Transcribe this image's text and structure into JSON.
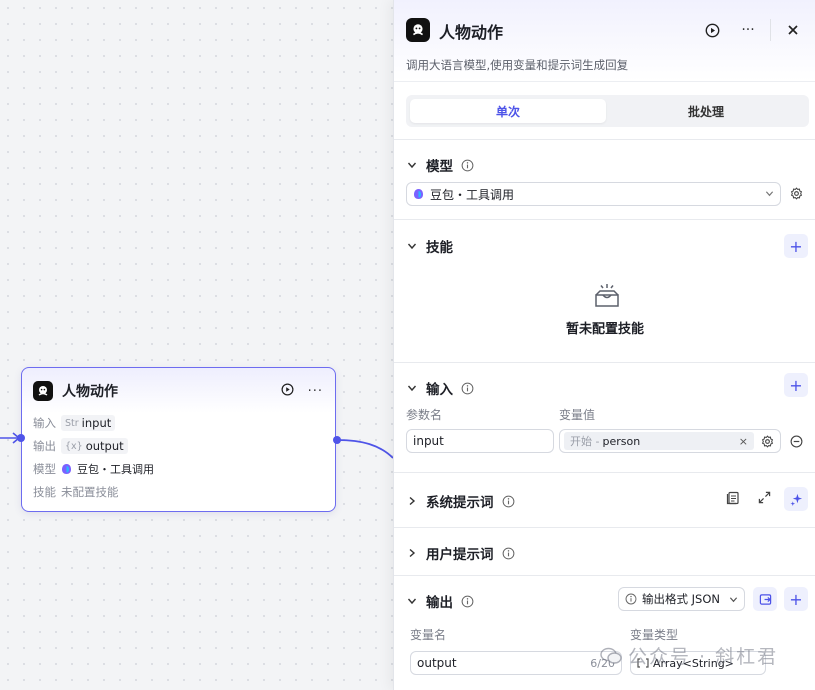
{
  "node": {
    "title": "人物动作",
    "rows": {
      "input_label": "输入",
      "input_type": "Str",
      "input_value": "input",
      "output_label": "输出",
      "output_type": "{x}",
      "output_value": "output",
      "model_label": "模型",
      "model_value": "豆包・工具调用",
      "skill_label": "技能",
      "skill_value": "未配置技能"
    }
  },
  "panel": {
    "title": "人物动作",
    "description": "调用大语言模型,使用变量和提示词生成回复",
    "tabs": [
      "单次",
      "批处理"
    ],
    "model": {
      "title": "模型",
      "value": "豆包・工具调用"
    },
    "skills": {
      "title": "技能",
      "empty": "暂未配置技能"
    },
    "input": {
      "title": "输入",
      "col_name": "参数名",
      "col_value": "变量值",
      "param_name": "input",
      "var_source": "开始 -",
      "var_name": "person"
    },
    "system_prompt": {
      "title": "系统提示词"
    },
    "user_prompt": {
      "title": "用户提示词"
    },
    "output": {
      "title": "输出",
      "format_label": "输出格式 JSON",
      "col_name": "变量名",
      "col_type": "变量类型",
      "var_name": "output",
      "counter": "6/20",
      "var_type": "Array<String>"
    }
  },
  "watermark": "公众号 · 斜杠君",
  "colors": {
    "accent": "#4d53e8",
    "node_border": "#6d6cf0",
    "plus_bg": "#eef0fd"
  }
}
